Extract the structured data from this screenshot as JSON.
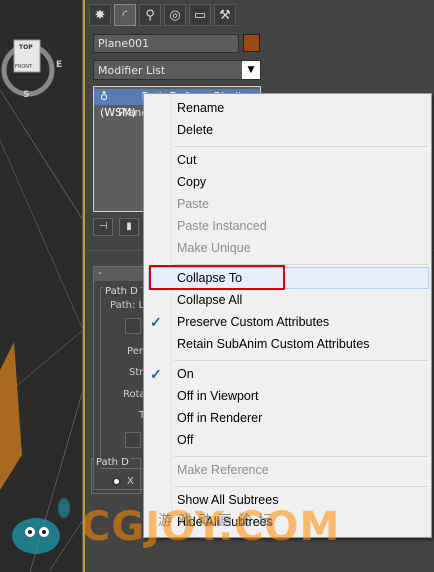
{
  "viewport": {
    "viewcube_top": "TOP",
    "viewcube_front": "FRONT",
    "compass_s": "S",
    "compass_e": "E"
  },
  "panel": {
    "tabs": [
      "create-icon",
      "modify-icon",
      "hierarchy-icon",
      "motion-icon",
      "display-icon",
      "utilities-icon"
    ],
    "object_name": "Plane001",
    "object_color": "#9a4a14",
    "modifier_list": "Modifier List",
    "stack_items": [
      "Path Deform Binding (WSM)",
      "Plane"
    ],
    "rollout_header": "-",
    "path_group_label": "Path D",
    "path_label": "Path: L",
    "labels": [
      "Per",
      "Str",
      "Rota",
      "T"
    ],
    "group2_label": "Path D",
    "radio_x": "X"
  },
  "context_menu": {
    "items": [
      {
        "label": "Rename",
        "enabled": true
      },
      {
        "label": "Delete",
        "enabled": true
      },
      {
        "label": "Cut",
        "enabled": true
      },
      {
        "label": "Copy",
        "enabled": true
      },
      {
        "label": "Paste",
        "enabled": false
      },
      {
        "label": "Paste Instanced",
        "enabled": false
      },
      {
        "label": "Make Unique",
        "enabled": false
      },
      {
        "label": "Collapse To",
        "enabled": true
      },
      {
        "label": "Collapse All",
        "enabled": true
      },
      {
        "label": "Preserve Custom Attributes",
        "enabled": true,
        "checked": true
      },
      {
        "label": "Retain SubAnim Custom Attributes",
        "enabled": true
      },
      {
        "label": "On",
        "enabled": true,
        "checked": true
      },
      {
        "label": "Off in Viewport",
        "enabled": true
      },
      {
        "label": "Off in Renderer",
        "enabled": true
      },
      {
        "label": "Off",
        "enabled": true
      },
      {
        "label": "Make Reference",
        "enabled": false
      },
      {
        "label": "Show All Subtrees",
        "enabled": true
      },
      {
        "label": "Hide All Subtrees",
        "enabled": true
      }
    ],
    "highlighted": "Collapse To",
    "check_glyph": "✓"
  },
  "watermark": {
    "brand": "CGJOY.COM",
    "chinese": "游戏动画论坛"
  },
  "colors": {
    "accent_border": "#b99a2a",
    "menu_bg": "#f0f0f0",
    "highlight_box": "#dd0000",
    "selected_row": "#5a7bb5"
  }
}
